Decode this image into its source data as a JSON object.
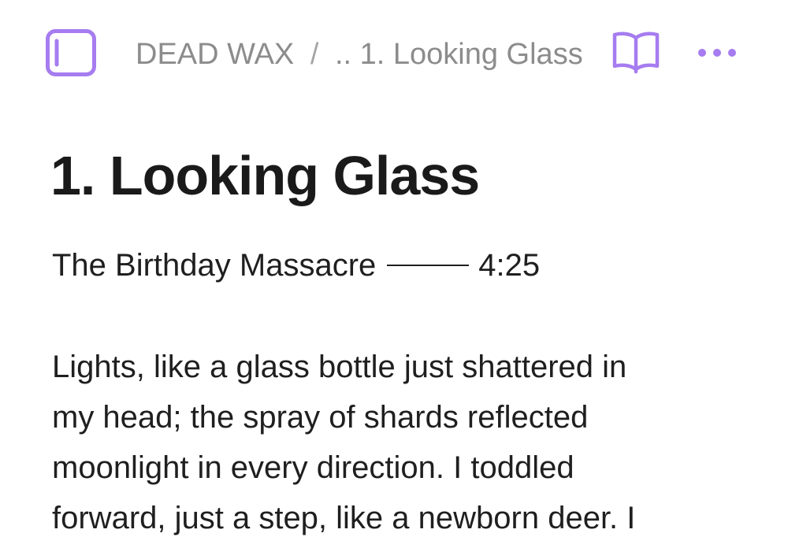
{
  "colors": {
    "accent": "#a67cf0",
    "breadcrumb_text": "#8c8c8c",
    "body_text": "#1f1f1f"
  },
  "header": {
    "sidebar_toggle_icon": "sidebar-panel-icon",
    "breadcrumb": {
      "parent": "DEAD WAX",
      "separator": "/",
      "current": ".. 1. Looking Glass"
    },
    "reading_mode_icon": "open-book-icon",
    "more_icon": "ellipsis-icon"
  },
  "document": {
    "title": "1. Looking Glass",
    "artist": "The Birthday Massacre",
    "duration": "4:25",
    "body_lines": [
      "Lights, like a glass bottle just shattered in",
      "my head; the spray of shards reflected",
      "moonlight in every direction. I toddled",
      "forward, just a step, like a newborn deer. I"
    ]
  }
}
